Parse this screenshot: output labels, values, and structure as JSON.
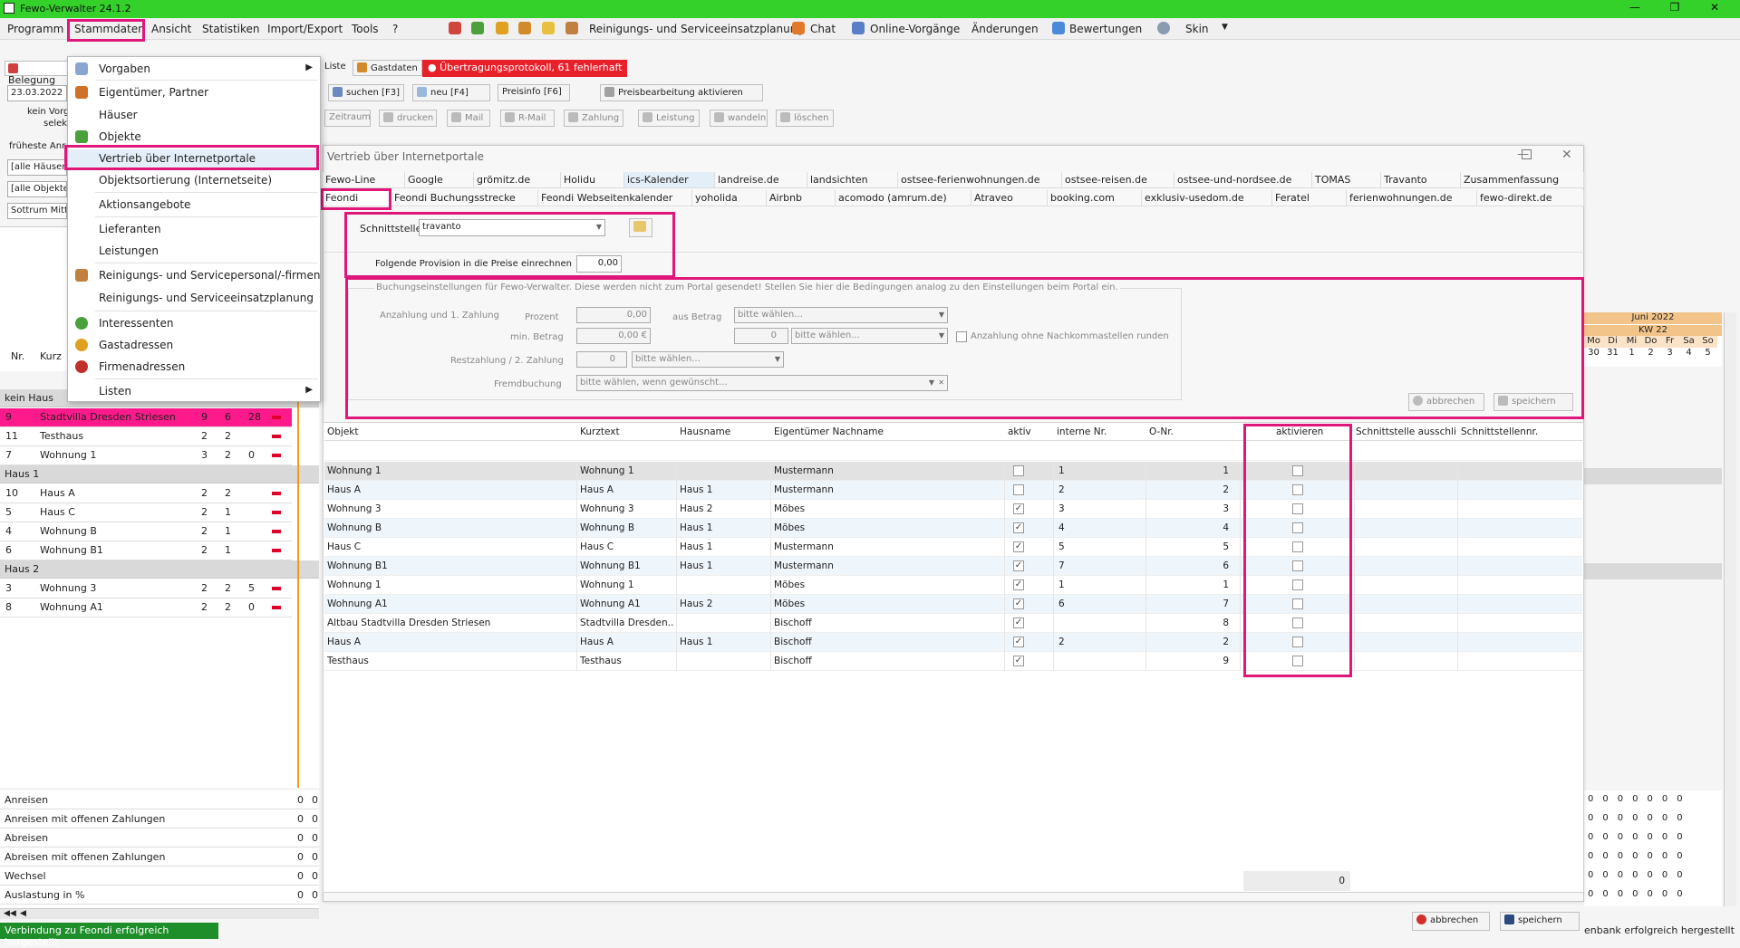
{
  "titlebar": {
    "title": "Fewo-Verwalter 24.1.2"
  },
  "menubar": {
    "items": [
      "Programm",
      "Stammdaten",
      "Ansicht",
      "Statistiken",
      "Import/Export",
      "Tools",
      "?"
    ],
    "tools": {
      "reinigung": "Reinigungs- und Serviceeinsatzplanung",
      "chat": "Chat",
      "online": "Online-Vorgänge",
      "aenderungen": "Änderungen",
      "bewertungen": "Bewertungen",
      "skin": "Skin"
    }
  },
  "dropdown_menu": {
    "items": [
      {
        "label": "Vorgaben",
        "has_submenu": true
      },
      {
        "label": "Eigentümer, Partner"
      },
      {
        "label": "Häuser"
      },
      {
        "label": "Objekte"
      },
      {
        "label": "Vertrieb über Internetportale"
      },
      {
        "label": "Objektsortierung (Internetseite)"
      },
      {
        "label": "Aktionsangebote"
      },
      {
        "label": "Lieferanten"
      },
      {
        "label": "Leistungen"
      },
      {
        "label": "Reinigungs- und Servicepersonal/-firmen"
      },
      {
        "label": "Reinigungs- und Serviceeinsatzplanung"
      },
      {
        "label": "Interessenten"
      },
      {
        "label": "Gastadressen"
      },
      {
        "label": "Firmenadressen"
      },
      {
        "label": "Listen",
        "has_submenu": true
      }
    ]
  },
  "left": {
    "belegung_tab": "Belegung",
    "date": "23.03.2022",
    "kein_vorgang": "kein Vorg",
    "selekt": "selek",
    "frueheste": "früheste Anr",
    "filter_haeuser": "[alle Häuser]",
    "filter_objekte": "[alle Objekte]",
    "filter_ort": "Sottrum Mitte",
    "col_nr": "Nr.",
    "col_kurz": "Kurz",
    "groups": [
      {
        "name": "kein Haus",
        "rows": [
          {
            "nr": "9",
            "name": "Stadtvilla Dresden Striesen",
            "a": "9",
            "b": "6",
            "c": "28",
            "selected": true
          },
          {
            "nr": "11",
            "name": "Testhaus",
            "a": "2",
            "b": "2",
            "c": ""
          },
          {
            "nr": "7",
            "name": "Wohnung 1",
            "a": "3",
            "b": "2",
            "c": "0"
          }
        ]
      },
      {
        "name": "Haus 1",
        "rows": [
          {
            "nr": "10",
            "name": "Haus A",
            "a": "2",
            "b": "2",
            "c": ""
          },
          {
            "nr": "5",
            "name": "Haus C",
            "a": "2",
            "b": "1",
            "c": ""
          },
          {
            "nr": "4",
            "name": "Wohnung B",
            "a": "2",
            "b": "1",
            "c": ""
          },
          {
            "nr": "6",
            "name": "Wohnung B1",
            "a": "2",
            "b": "1",
            "c": ""
          }
        ]
      },
      {
        "name": "Haus 2",
        "rows": [
          {
            "nr": "3",
            "name": "Wohnung 3",
            "a": "2",
            "b": "2",
            "c": "5"
          },
          {
            "nr": "8",
            "name": "Wohnung A1",
            "a": "2",
            "b": "2",
            "c": "0"
          }
        ]
      }
    ],
    "summary": [
      {
        "label": "Anreisen",
        "v1": "0",
        "v2": "0"
      },
      {
        "label": "Anreisen mit offenen Zahlungen",
        "v1": "0",
        "v2": "0"
      },
      {
        "label": "Abreisen",
        "v1": "0",
        "v2": "0"
      },
      {
        "label": "Abreisen mit offenen Zahlungen",
        "v1": "0",
        "v2": "0"
      },
      {
        "label": "Wechsel",
        "v1": "0",
        "v2": "0"
      },
      {
        "label": "Auslastung in %",
        "v1": "0",
        "v2": "0"
      }
    ],
    "status": "Verbindung zu Feondi erfolgreich hergestellt"
  },
  "toolbar": {
    "tabs": [
      "Liste",
      "Gastdaten",
      "Übertragungsprotokoll, 61 fehlerhaft"
    ],
    "row1": [
      "suchen [F3]",
      "neu [F4]",
      "Preisinfo [F6]",
      "Preisbearbeitung aktivieren"
    ],
    "row2": [
      "Zeitraum",
      "drucken",
      "Mail",
      "R-Mail",
      "Zahlung",
      "Leistung",
      "wandeln",
      "löschen"
    ]
  },
  "dialog": {
    "title": "Vertrieb über Internetportale",
    "tabs_row1": [
      "Fewo-Line",
      "Google",
      "grömitz.de",
      "Holidu",
      "ics-Kalender",
      "landreise.de",
      "landsichten",
      "ostsee-ferienwohnungen.de",
      "ostsee-reisen.de",
      "ostsee-und-nordsee.de",
      "TOMAS",
      "Travanto",
      "Zusammenfassung"
    ],
    "tabs_row2": [
      "Feondi",
      "Feondi Buchungsstrecke",
      "Feondi Webseitenkalender",
      "yoholida",
      "Airbnb",
      "acomodo (amrum.de)",
      "Atraveo",
      "booking.com",
      "exklusiv-usedom.de",
      "Feratel",
      "ferienwohnungen.de",
      "fewo-direkt.de"
    ],
    "schnittstelle_label": "Schnittstelle",
    "schnittstelle_value": "travanto",
    "provision_label": "Folgende Provision in die Preise einrechnen",
    "provision_value": "0,00",
    "booking_settings": {
      "caption": "Buchungseinstellungen für Fewo-Verwalter. Diese werden nicht zum Portal gesendet! Stellen Sie hier die Bedingungen analog zu den Einstellungen beim Portal ein.",
      "anzahlung_label": "Anzahlung und 1. Zahlung",
      "prozent_label": "Prozent",
      "prozent_value": "0,00",
      "aus_betrag_label": "aus Betrag",
      "aus_betrag_value": "bitte wählen...",
      "min_betrag_label": "min. Betrag",
      "min_betrag_value": "0,00 €",
      "spin1_value": "0",
      "select2_value": "bitte wählen...",
      "round_label": "Anzahlung ohne Nachkommastellen runden",
      "rest_label": "Restzahlung / 2. Zahlung",
      "rest_value": "0",
      "rest_select": "bitte wählen...",
      "fremd_label": "Fremdbuchung",
      "fremd_value": "bitte wählen, wenn gewünscht..."
    },
    "buttons": {
      "cancel": "abbrechen",
      "save": "speichern"
    },
    "grid": {
      "columns": [
        "Objekt",
        "Kurztext",
        "Hausname",
        "Eigentümer Nachname",
        "aktiv",
        "interne Nr.",
        "O-Nr.",
        "aktivieren",
        "Schnittstelle ausschli...",
        "Schnittstellennr."
      ],
      "rows": [
        {
          "objekt": "Wohnung 1",
          "kurz": "Wohnung 1",
          "haus": "",
          "eig": "Mustermann",
          "aktiv": false,
          "intern": "1",
          "onr": "1",
          "akt": false
        },
        {
          "objekt": "Haus A",
          "kurz": "Haus A",
          "haus": "Haus 1",
          "eig": "Mustermann",
          "aktiv": false,
          "intern": "2",
          "onr": "2",
          "akt": false
        },
        {
          "objekt": "Wohnung 3",
          "kurz": "Wohnung 3",
          "haus": "Haus 2",
          "eig": "Möbes",
          "aktiv": true,
          "intern": "3",
          "onr": "3",
          "akt": false
        },
        {
          "objekt": "Wohnung B",
          "kurz": "Wohnung B",
          "haus": "Haus 1",
          "eig": "Möbes",
          "aktiv": true,
          "intern": "4",
          "onr": "4",
          "akt": false
        },
        {
          "objekt": "Haus C",
          "kurz": "Haus C",
          "haus": "Haus 1",
          "eig": "Mustermann",
          "aktiv": true,
          "intern": "5",
          "onr": "5",
          "akt": false
        },
        {
          "objekt": "Wohnung B1",
          "kurz": "Wohnung B1",
          "haus": "Haus 1",
          "eig": "Mustermann",
          "aktiv": true,
          "intern": "7",
          "onr": "6",
          "akt": false
        },
        {
          "objekt": "Wohnung 1",
          "kurz": "Wohnung 1",
          "haus": "",
          "eig": "Möbes",
          "aktiv": true,
          "intern": "1",
          "onr": "1",
          "akt": false
        },
        {
          "objekt": "Wohnung A1",
          "kurz": "Wohnung A1",
          "haus": "Haus 2",
          "eig": "Möbes",
          "aktiv": true,
          "intern": "6",
          "onr": "7",
          "akt": false
        },
        {
          "objekt": "Altbau Stadtvilla Dresden Striesen",
          "kurz": "Stadtvilla Dresden...",
          "haus": "",
          "eig": "Bischoff",
          "aktiv": true,
          "intern": "",
          "onr": "8",
          "akt": false
        },
        {
          "objekt": "Haus A",
          "kurz": "Haus A",
          "haus": "Haus 1",
          "eig": "Bischoff",
          "aktiv": true,
          "intern": "2",
          "onr": "2",
          "akt": false
        },
        {
          "objekt": "Testhaus",
          "kurz": "Testhaus",
          "haus": "",
          "eig": "Bischoff",
          "aktiv": true,
          "intern": "",
          "onr": "9",
          "akt": false
        }
      ],
      "footer_count": "0"
    }
  },
  "calendar": {
    "month": "Juni 2022",
    "week": "KW 22",
    "days": [
      "Mo",
      "Di",
      "Mi",
      "Do",
      "Fr",
      "Sa",
      "So"
    ],
    "dates": [
      "30",
      "31",
      "1",
      "2",
      "3",
      "4",
      "5"
    ],
    "zeros": "0"
  },
  "bottom": {
    "cancel": "abbrechen",
    "save": "speichern",
    "status_right": "enbank erfolgreich hergestellt"
  },
  "colors": {
    "accent": "#e0177a",
    "titlebar": "#34d12a",
    "selected_row": "#ff1a8c",
    "protocol_tab": "#e8202a"
  }
}
